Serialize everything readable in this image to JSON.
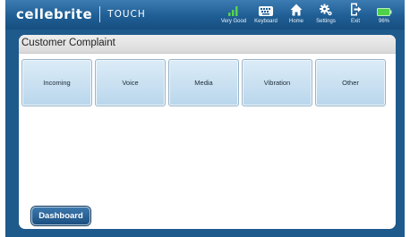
{
  "header": {
    "brand": "cellebrite",
    "product": "TOUCH",
    "items": [
      {
        "label": "Very Good",
        "icon": "signal-icon"
      },
      {
        "label": "Keyboard",
        "icon": "keyboard-icon"
      },
      {
        "label": "Home",
        "icon": "home-icon"
      },
      {
        "label": "Settings",
        "icon": "gear-icon"
      },
      {
        "label": "Exit",
        "icon": "exit-icon"
      },
      {
        "label": "96%",
        "icon": "battery-icon"
      }
    ]
  },
  "panel": {
    "title": "Customer Complaint",
    "options": [
      "Incoming",
      "Voice",
      "Media",
      "Vibration",
      "Other"
    ]
  },
  "footer": {
    "dashboard_label": "Dashboard"
  },
  "colors": {
    "topbar": "#1f5e94",
    "frame": "#1e5a8c",
    "tile": "#c9e0f1",
    "battery": "#4fd14a"
  }
}
